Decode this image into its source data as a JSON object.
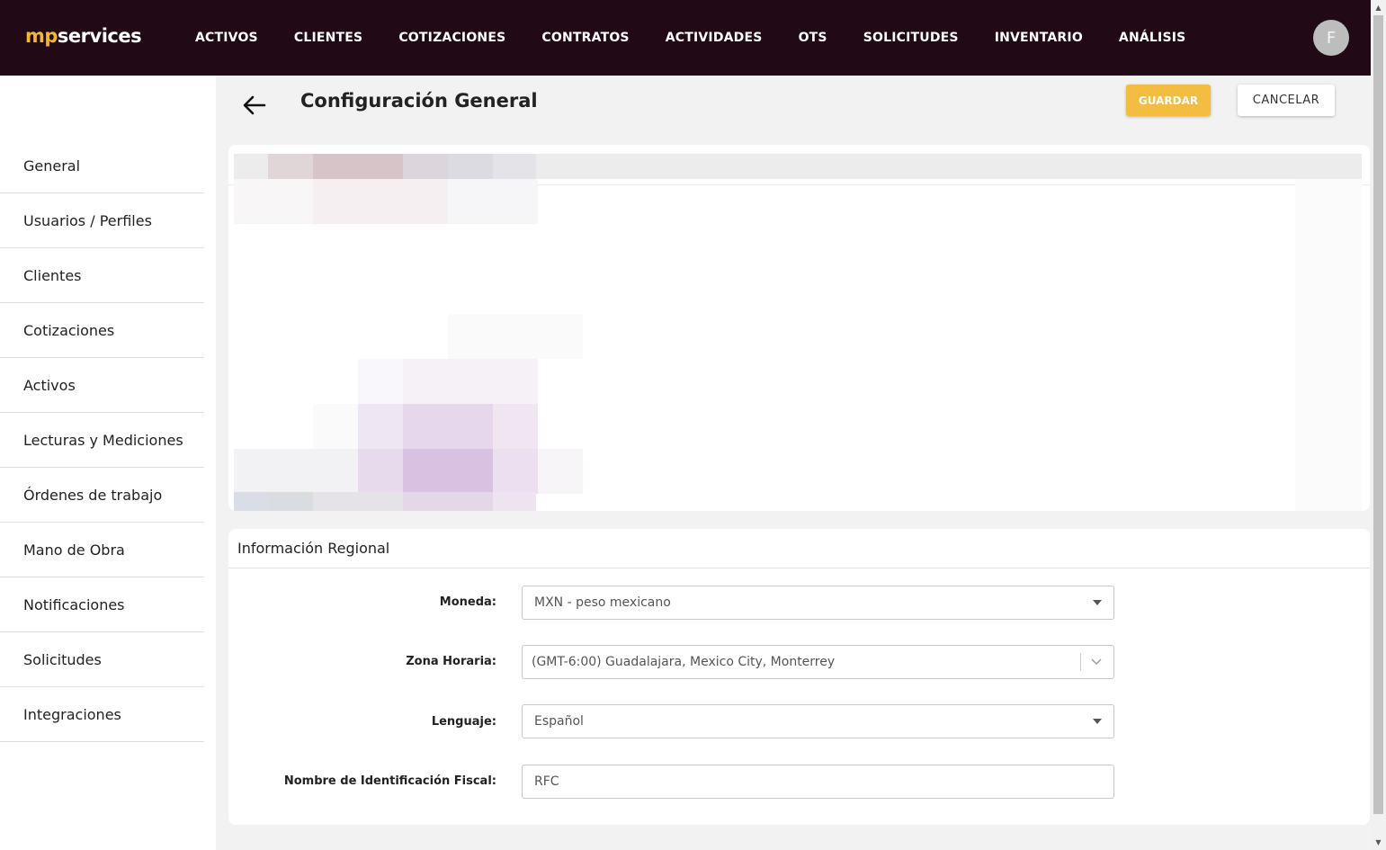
{
  "brand": {
    "prefix": "mp",
    "suffix": "services"
  },
  "nav": [
    "ACTIVOS",
    "CLIENTES",
    "COTIZACIONES",
    "CONTRATOS",
    "ACTIVIDADES",
    "OTS",
    "SOLICITUDES",
    "INVENTARIO",
    "ANÁLISIS"
  ],
  "user": {
    "initial": "F"
  },
  "sidebar": {
    "items": [
      "General",
      "Usuarios / Perfiles",
      "Clientes",
      "Cotizaciones",
      "Activos",
      "Lecturas y Mediciones",
      "Órdenes de trabajo",
      "Mano de Obra",
      "Notificaciones",
      "Solicitudes",
      "Integraciones"
    ]
  },
  "header": {
    "title": "Configuración General",
    "save_label": "GUARDAR",
    "cancel_label": "CANCELAR"
  },
  "regional": {
    "title": "Información Regional",
    "currency": {
      "label": "Moneda:",
      "value": "MXN - peso mexicano"
    },
    "timezone": {
      "label": "Zona Horaria:",
      "value": "(GMT-6:00) Guadalajara, Mexico City, Monterrey"
    },
    "language": {
      "label": "Lenguaje:",
      "value": "Español"
    },
    "fiscal_id": {
      "label": "Nombre de Identificación Fiscal:",
      "value": "RFC"
    }
  },
  "colors": {
    "topbar": "#210a16",
    "brand_accent": "#f2b632",
    "save_button": "#f2bd40"
  },
  "icons": {
    "back": "arrow-left-icon",
    "select_caret": "caret-down-icon",
    "timezone_chevron": "chevron-down-icon"
  }
}
